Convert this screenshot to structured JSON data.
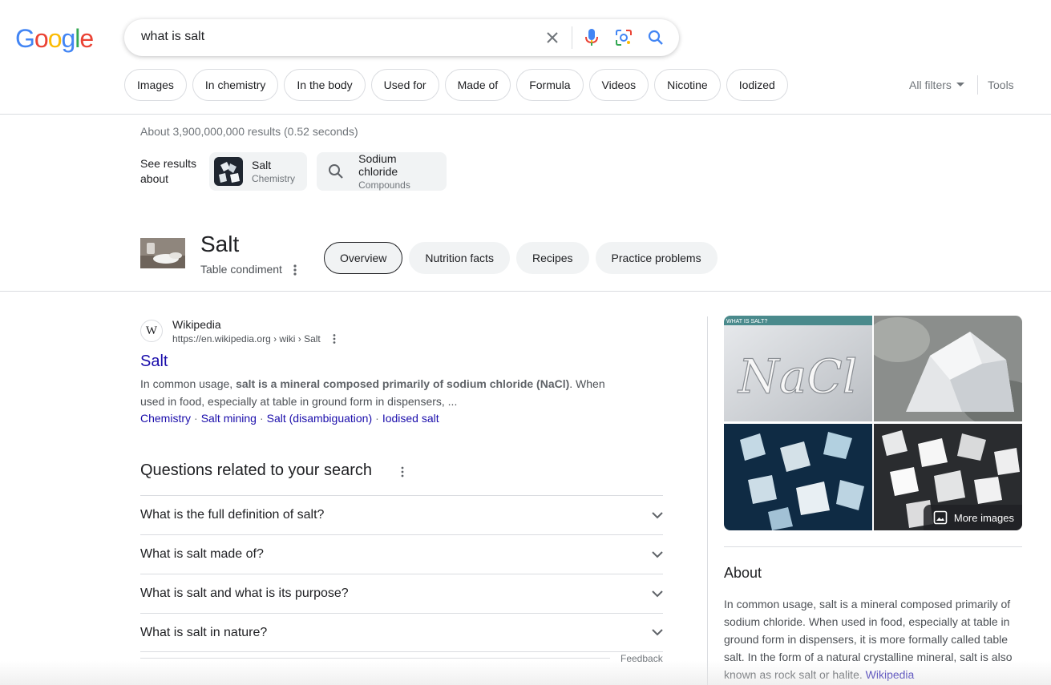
{
  "search": {
    "query": "what is salt"
  },
  "chips": [
    "Images",
    "In chemistry",
    "In the body",
    "Used for",
    "Made of",
    "Formula",
    "Videos",
    "Nicotine",
    "Iodized"
  ],
  "filters": {
    "all_filters": "All filters",
    "tools": "Tools"
  },
  "stats": "About 3,900,000,000 results (0.52 seconds)",
  "see_results_about": {
    "label": "See results about",
    "cards": [
      {
        "title": "Salt",
        "subtitle": "Chemistry"
      },
      {
        "title": "Sodium chloride",
        "subtitle": "Compounds"
      }
    ]
  },
  "entity": {
    "title": "Salt",
    "subtitle": "Table condiment",
    "tabs": [
      "Overview",
      "Nutrition facts",
      "Recipes",
      "Practice problems"
    ],
    "active_tab": "Overview"
  },
  "result": {
    "site_name": "Wikipedia",
    "url": "https://en.wikipedia.org › wiki › Salt",
    "title": "Salt",
    "snippet_pre": "In common usage, ",
    "snippet_bold": "salt is a mineral composed primarily of sodium chloride (NaCl)",
    "snippet_post": ". When used in food, especially at table in ground form in dispensers, ...",
    "links": [
      "Chemistry",
      "Salt mining",
      "Salt (disambiguation)",
      "Iodised salt"
    ]
  },
  "paa": {
    "title": "Questions related to your search",
    "questions": [
      "What is the full definition of salt?",
      "What is salt made of?",
      "What is salt and what is its purpose?",
      "What is salt in nature?"
    ],
    "feedback": "Feedback"
  },
  "panel": {
    "image1_caption": "WHAT IS SALT?",
    "image1_text": "NaCl",
    "more_images": "More images",
    "about_title": "About",
    "about_text": "In common usage, salt is a mineral composed primarily of sodium chloride. When used in food, especially at table in ground form in dispensers, it is more formally called table salt. In the form of a natural crystalline mineral, salt is also known as rock salt or halite.",
    "about_link": "Wikipedia"
  },
  "colors": {
    "link": "#1a0dab",
    "google_blue": "#4285f4",
    "google_red": "#ea4335",
    "google_yellow": "#fbbc05",
    "google_green": "#34a853"
  }
}
